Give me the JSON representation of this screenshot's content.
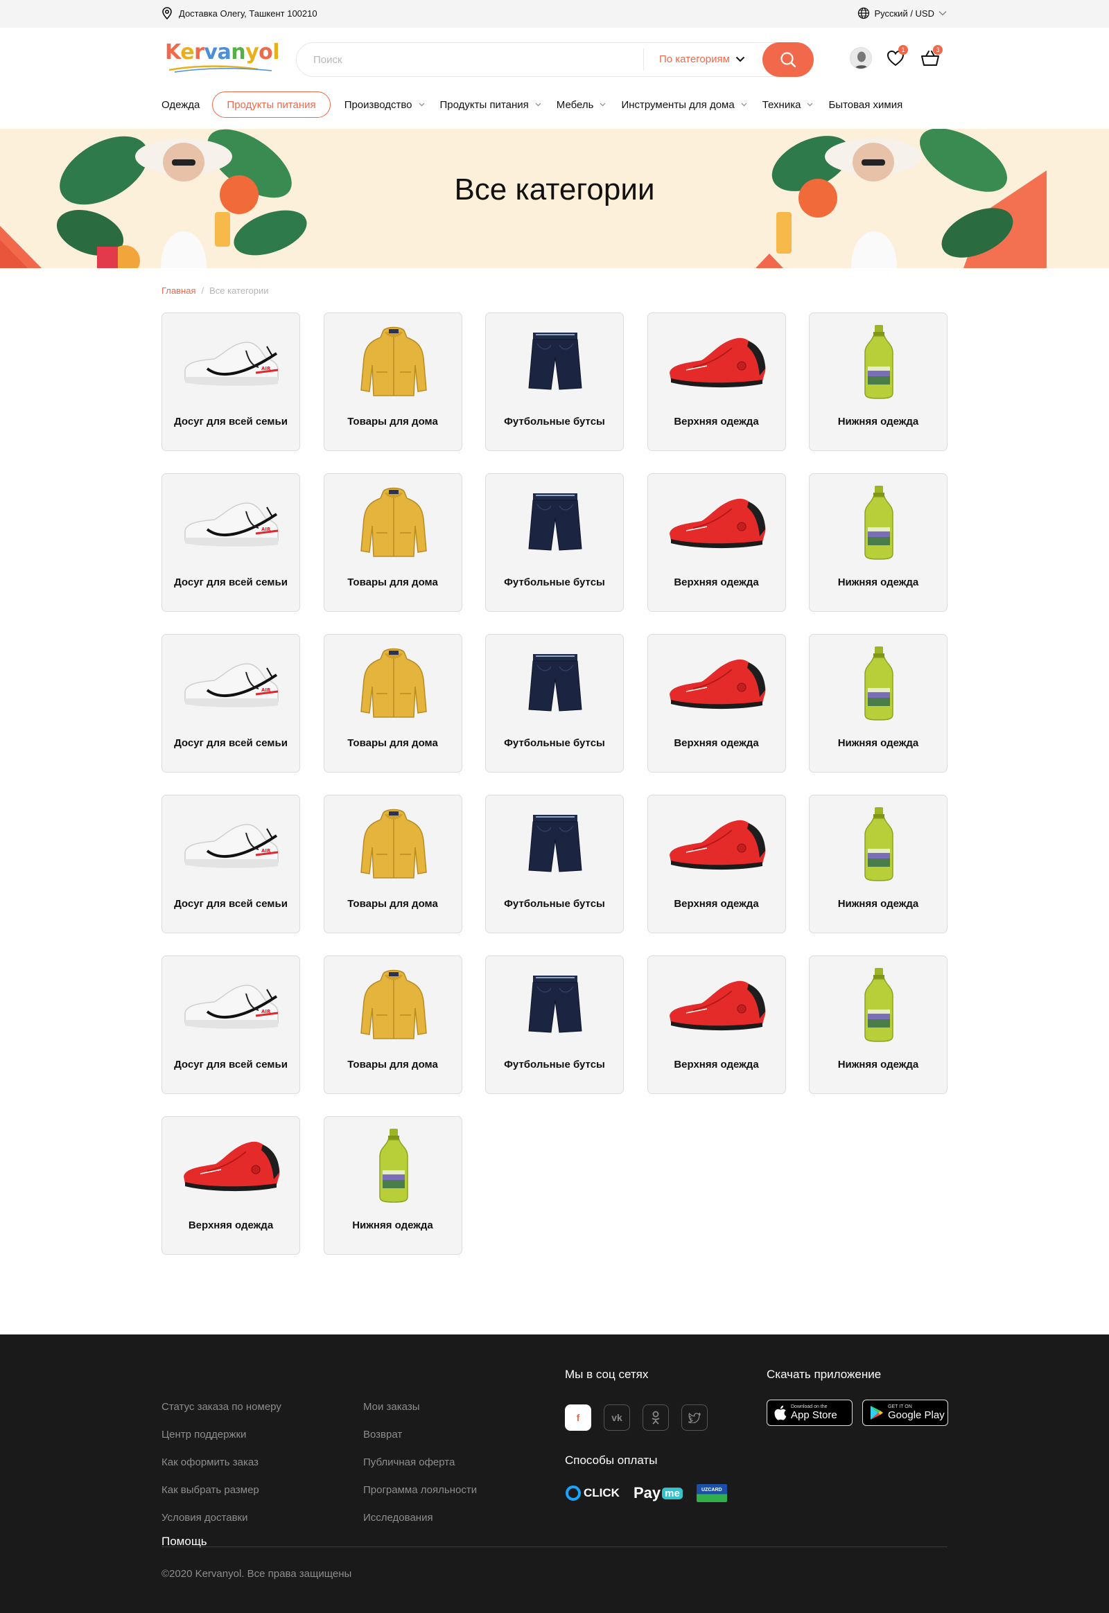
{
  "topbar": {
    "location": "Доставка Олегу, Ташкент 100210",
    "language": "Русский / USD"
  },
  "header": {
    "logo": "Kervanyol",
    "logo_sub": "Kervanyol",
    "search_placeholder": "Поиск",
    "search_category": "По категориям",
    "wishlist_count": "1",
    "cart_count": "3"
  },
  "nav": {
    "items": [
      {
        "label": "Одежда",
        "dropdown": false
      },
      {
        "label": "Продукты питания",
        "dropdown": false,
        "active": true
      },
      {
        "label": "Производство",
        "dropdown": true
      },
      {
        "label": "Продукты питания",
        "dropdown": true
      },
      {
        "label": "Мебель",
        "dropdown": true
      },
      {
        "label": "Инструменты для дома",
        "dropdown": true
      },
      {
        "label": "Техника",
        "dropdown": true
      },
      {
        "label": "Бытовая химия",
        "dropdown": false
      }
    ]
  },
  "hero": {
    "title": "Все категории"
  },
  "breadcrumb": {
    "home": "Главная",
    "current": "Все категории"
  },
  "categories": [
    {
      "label": "Досуг для всей семьи",
      "icon": "sneaker-white-icon"
    },
    {
      "label": "Товары для дома",
      "icon": "yellow-jacket-icon"
    },
    {
      "label": "Футбольные бутсы",
      "icon": "navy-shorts-icon"
    },
    {
      "label": "Верхняя одежда",
      "icon": "red-shoe-icon"
    },
    {
      "label": "Нижняя одежда",
      "icon": "green-bottle-icon"
    },
    {
      "label": "Досуг для всей семьи",
      "icon": "sneaker-white-icon"
    },
    {
      "label": "Товары для дома",
      "icon": "yellow-jacket-icon"
    },
    {
      "label": "Футбольные бутсы",
      "icon": "navy-shorts-icon"
    },
    {
      "label": "Верхняя одежда",
      "icon": "red-shoe-icon"
    },
    {
      "label": "Нижняя одежда",
      "icon": "green-bottle-icon"
    },
    {
      "label": "Досуг для всей семьи",
      "icon": "sneaker-white-icon"
    },
    {
      "label": "Товары для дома",
      "icon": "yellow-jacket-icon"
    },
    {
      "label": "Футбольные бутсы",
      "icon": "navy-shorts-icon"
    },
    {
      "label": "Верхняя одежда",
      "icon": "red-shoe-icon"
    },
    {
      "label": "Нижняя одежда",
      "icon": "green-bottle-icon"
    },
    {
      "label": "Досуг для всей семьи",
      "icon": "sneaker-white-icon"
    },
    {
      "label": "Товары для дома",
      "icon": "yellow-jacket-icon"
    },
    {
      "label": "Футбольные бутсы",
      "icon": "navy-shorts-icon"
    },
    {
      "label": "Верхняя одежда",
      "icon": "red-shoe-icon"
    },
    {
      "label": "Нижняя одежда",
      "icon": "green-bottle-icon"
    },
    {
      "label": "Досуг для всей семьи",
      "icon": "sneaker-white-icon"
    },
    {
      "label": "Товары для дома",
      "icon": "yellow-jacket-icon"
    },
    {
      "label": "Футбольные бутсы",
      "icon": "navy-shorts-icon"
    },
    {
      "label": "Верхняя одежда",
      "icon": "red-shoe-icon"
    },
    {
      "label": "Нижняя одежда",
      "icon": "green-bottle-icon"
    },
    {
      "label": "Верхняя одежда",
      "icon": "red-shoe-icon"
    },
    {
      "label": "Нижняя одежда",
      "icon": "green-bottle-icon"
    }
  ],
  "footer": {
    "col1": [
      "Статус заказа по номеру",
      "Центр поддержки",
      "Как оформить заказ",
      "Как выбрать размер",
      "Условия доставки"
    ],
    "help": "Помощь",
    "col2": [
      "Мои заказы",
      "Возврат",
      "Публичная оферта",
      "Программа лояльности",
      "Исследования"
    ],
    "social_title": "Мы в соц сетях",
    "social": [
      "f",
      "vk",
      "ok",
      "tw"
    ],
    "app_title": "Скачать приложение",
    "appstore_small": "Download on the",
    "appstore_big": "App Store",
    "gplay_small": "GET IT ON",
    "gplay_big": "Google Play",
    "payment_title": "Способы оплаты",
    "payments": [
      "CLICK",
      "Pay",
      "me",
      "UZCARD"
    ],
    "copyright": "©2020 Kervanyol. Все права защищены"
  },
  "colors": {
    "accent": "#f2684a",
    "hero_bg": "#fdf0da",
    "footer_bg": "#1a1a1a",
    "card_bg": "#f4f4f4"
  }
}
